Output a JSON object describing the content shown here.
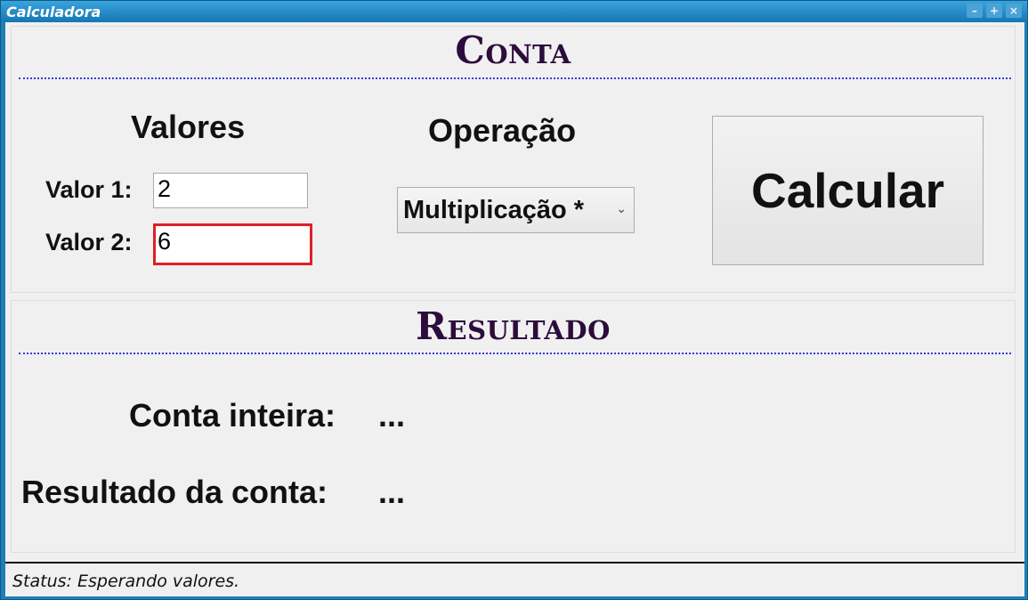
{
  "window": {
    "title": "Calculadora",
    "controls": {
      "minimize": "–",
      "maximize": "+",
      "close": "×"
    }
  },
  "conta": {
    "title": "Conta",
    "valores_heading": "Valores",
    "valor1_label": "Valor 1:",
    "valor1_value": "2",
    "valor2_label": "Valor 2:",
    "valor2_value": "6",
    "operacao_heading": "Operação",
    "operacao_selected": "Multiplicação *",
    "calcular_label": "Calcular"
  },
  "resultado": {
    "title": "Resultado",
    "conta_inteira_label": "Conta inteira:",
    "conta_inteira_value": "...",
    "resultado_label": "Resultado da conta:",
    "resultado_value": "..."
  },
  "status": {
    "text": "Status: Esperando valores."
  },
  "colors": {
    "titlebar": "#1f7fb5",
    "group_title": "#2c0c3c",
    "divider": "#3a3adf",
    "focus_border": "#e11f26"
  }
}
